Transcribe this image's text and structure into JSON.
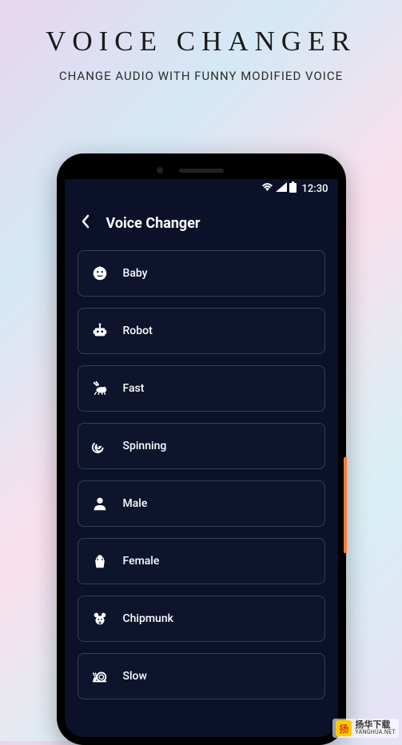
{
  "hero": {
    "title": "VOICE CHANGER",
    "subtitle": "CHANGE AUDIO WITH FUNNY MODIFIED VOICE"
  },
  "status": {
    "time": "12:30"
  },
  "header": {
    "title": "Voice Changer"
  },
  "voices": {
    "items": [
      {
        "label": "Baby",
        "icon": "baby"
      },
      {
        "label": "Robot",
        "icon": "robot"
      },
      {
        "label": "Fast",
        "icon": "fast"
      },
      {
        "label": "Spinning",
        "icon": "spinning"
      },
      {
        "label": "Male",
        "icon": "male"
      },
      {
        "label": "Female",
        "icon": "female"
      },
      {
        "label": "Chipmunk",
        "icon": "chipmunk"
      },
      {
        "label": "Slow",
        "icon": "slow"
      }
    ]
  },
  "watermark": {
    "name": "扬华下载",
    "url": "YANGHUA.NET"
  }
}
